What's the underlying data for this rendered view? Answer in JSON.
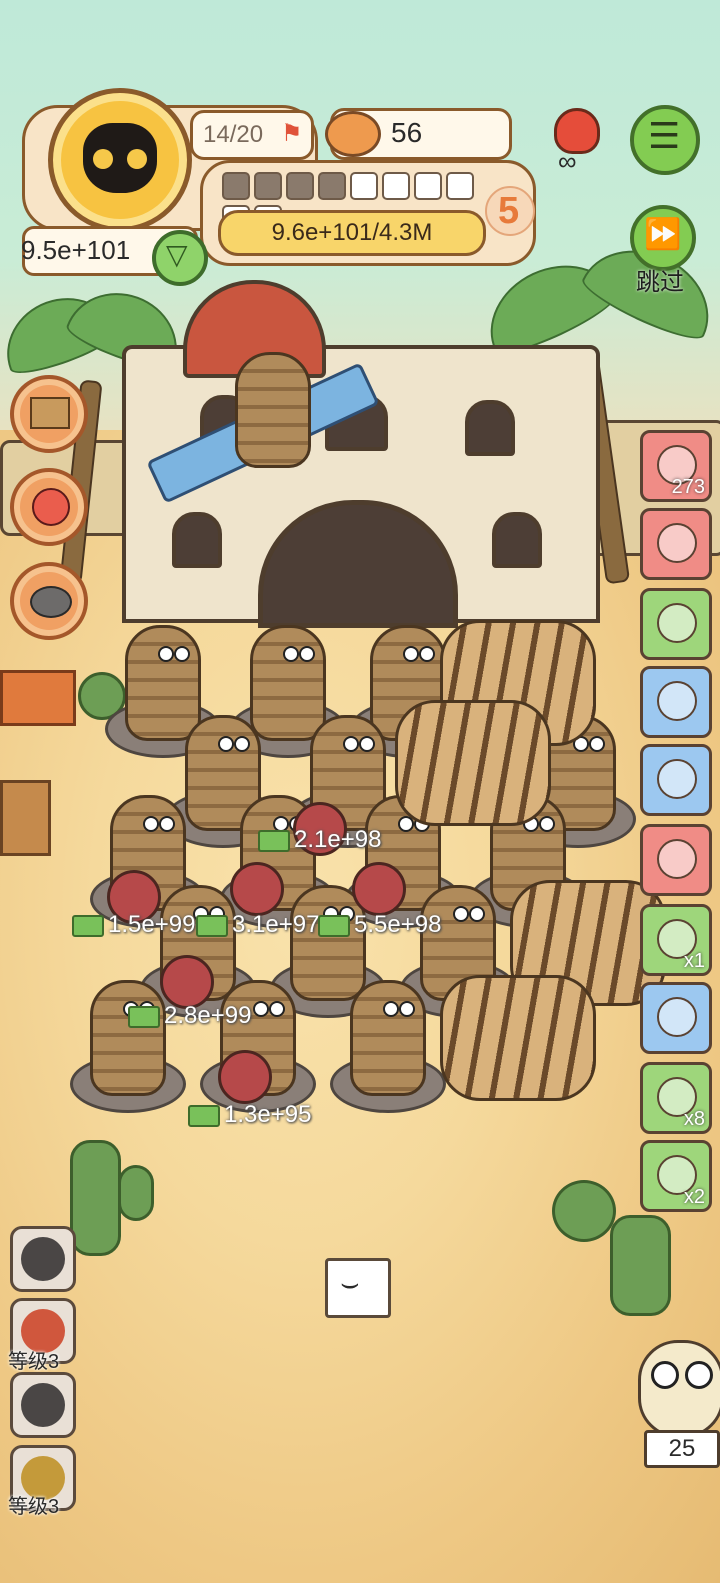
{
  "hud": {
    "stage_progress": "14/20",
    "can_count": "56",
    "gold_total": "9.5e+101",
    "gold_bar": "9.6e+101/4.3M",
    "level_badge": "5",
    "progress_segments_filled": 4,
    "progress_segments_total": 10,
    "skip_label": "跳过"
  },
  "right_cards": [
    {
      "icon": "film-reel-icon",
      "color": "#f08c86",
      "count": "273"
    },
    {
      "icon": "green-slime-icon",
      "color": "#f08c86",
      "count": ""
    },
    {
      "icon": "credit-card-icon",
      "color": "#9ed67b",
      "count": ""
    },
    {
      "icon": "wings-icon",
      "color": "#9cc8f0",
      "count": ""
    },
    {
      "icon": "furnace-icon",
      "color": "#9cc8f0",
      "count": ""
    },
    {
      "icon": "hanging-bag-icon",
      "color": "#f08c86",
      "count": ""
    },
    {
      "icon": "sack-icon",
      "color": "#9ed67b",
      "count": "x1"
    },
    {
      "icon": "hut-icon",
      "color": "#9cc8f0",
      "count": ""
    },
    {
      "icon": "ticket-icon",
      "color": "#9ed67b",
      "count": "x8"
    },
    {
      "icon": "tent-icon",
      "color": "#9ed67b",
      "count": "x2"
    }
  ],
  "skills": [
    {
      "icon": "monster-skill-icon",
      "level": ""
    },
    {
      "icon": "meat-skill-icon",
      "level": "等级3"
    },
    {
      "icon": "bush-skill-icon",
      "level": ""
    },
    {
      "icon": "skull-skill-icon",
      "level": "等级3"
    }
  ],
  "damage_numbers": [
    "2.1e+98",
    "1.5e+99",
    "3.1e+97",
    "5.5e+98",
    "2.8e+99",
    "1.3e+95"
  ],
  "owl_count": "25"
}
